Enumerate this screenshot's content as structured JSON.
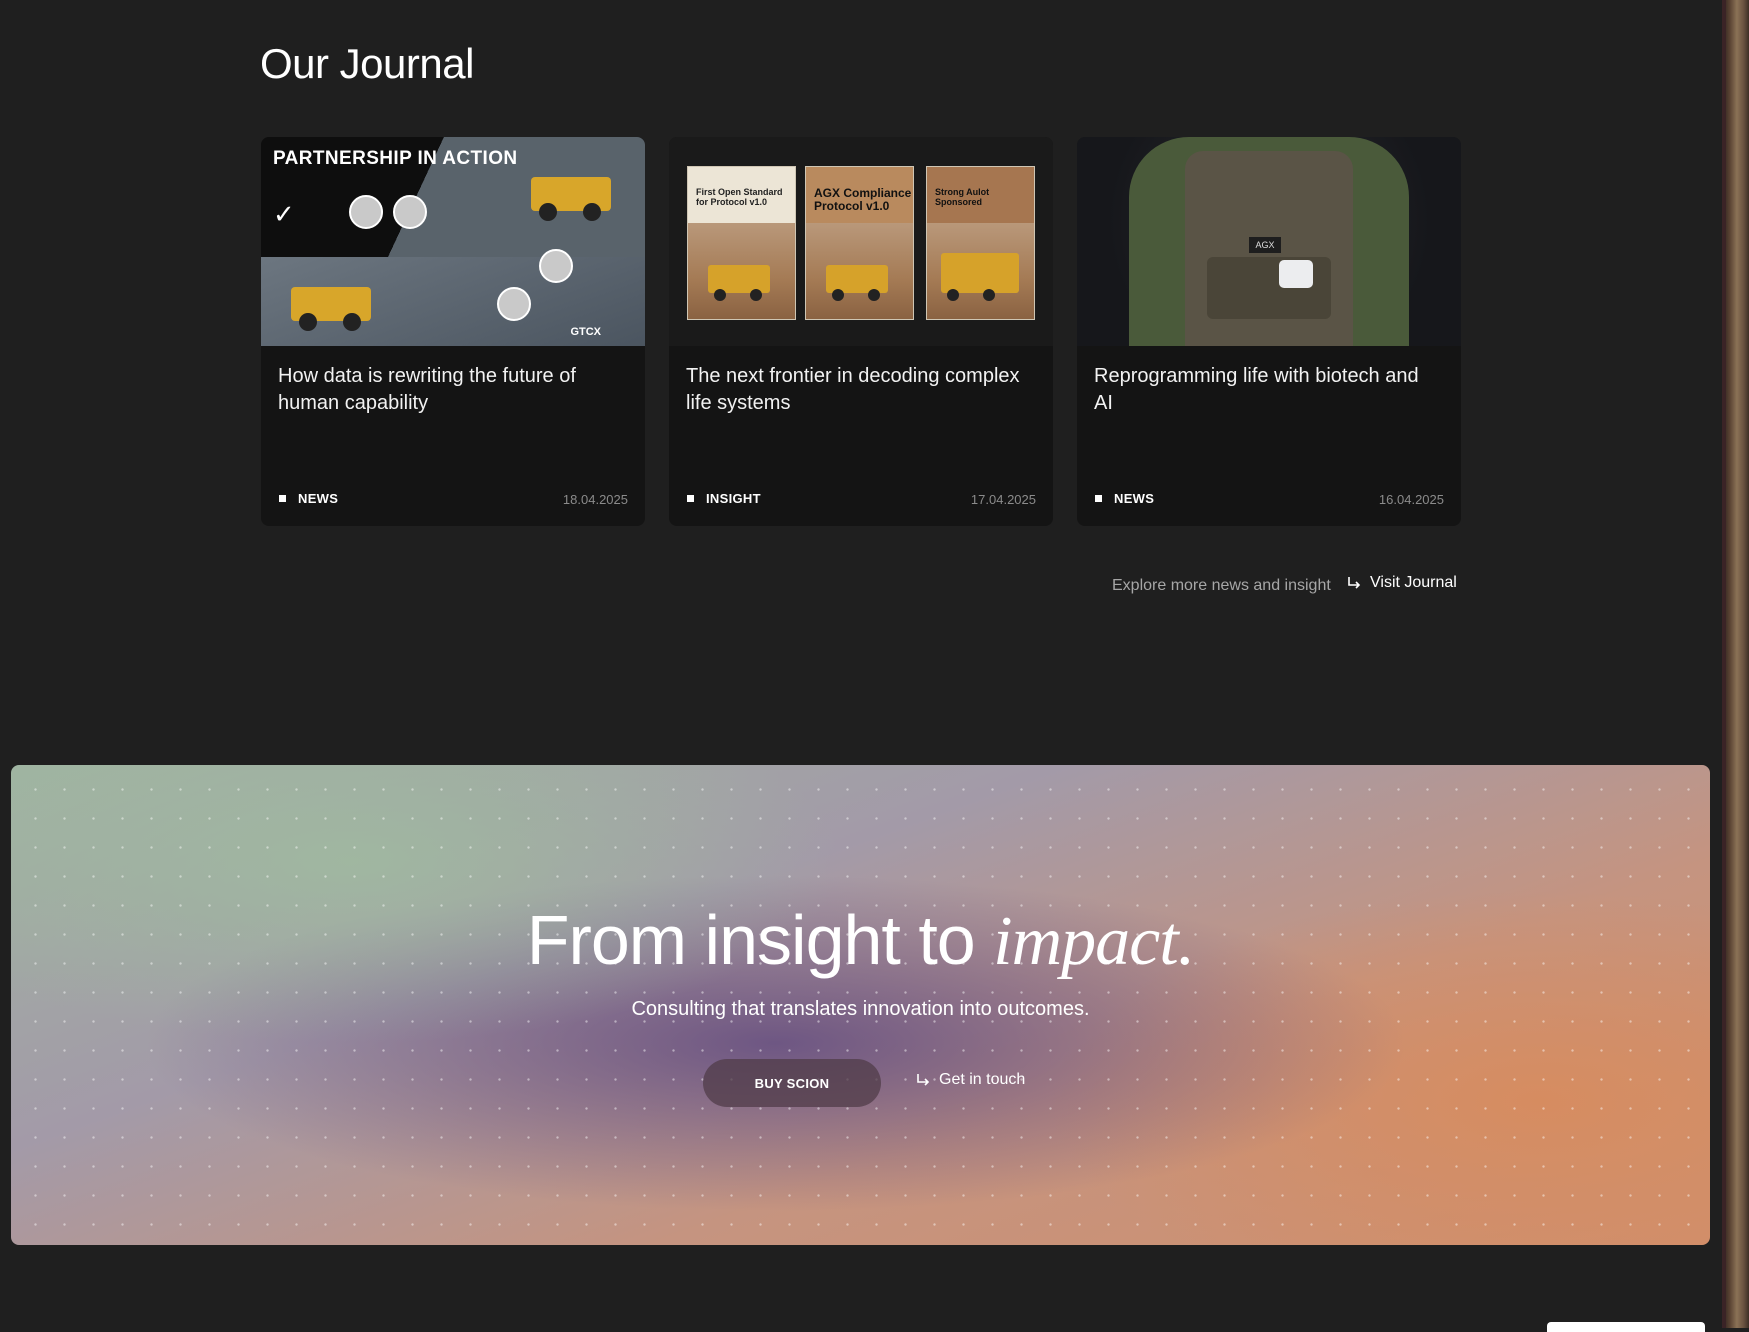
{
  "journal": {
    "title": "Our Journal",
    "cards": [
      {
        "title": "How data is rewriting the future of human capability",
        "tag": "NEWS",
        "date": "18.04.2025",
        "image": {
          "headline": "PARTNERSHIP IN ACTION",
          "brand": "GTCX"
        }
      },
      {
        "title": "The next frontier in decoding complex life systems",
        "tag": "INSIGHT",
        "date": "17.04.2025",
        "image": {
          "docs": [
            "First Open Standard for Protocol v1.0",
            "AGX Compliance Protocol v1.0",
            "Strong Aulot Sponsored"
          ]
        }
      },
      {
        "title": "Reprogramming life with biotech and AI",
        "tag": "NEWS",
        "date": "16.04.2025",
        "image": {
          "badge": "AGX"
        }
      }
    ],
    "explore_text": "Explore more news and insight",
    "visit_label": "Visit Journal"
  },
  "cta": {
    "title_plain": "From insight to ",
    "title_italic": "impact.",
    "subtitle": "Consulting that translates innovation into outcomes.",
    "primary_label": "BUY SCION",
    "secondary_label": "Get in touch"
  }
}
